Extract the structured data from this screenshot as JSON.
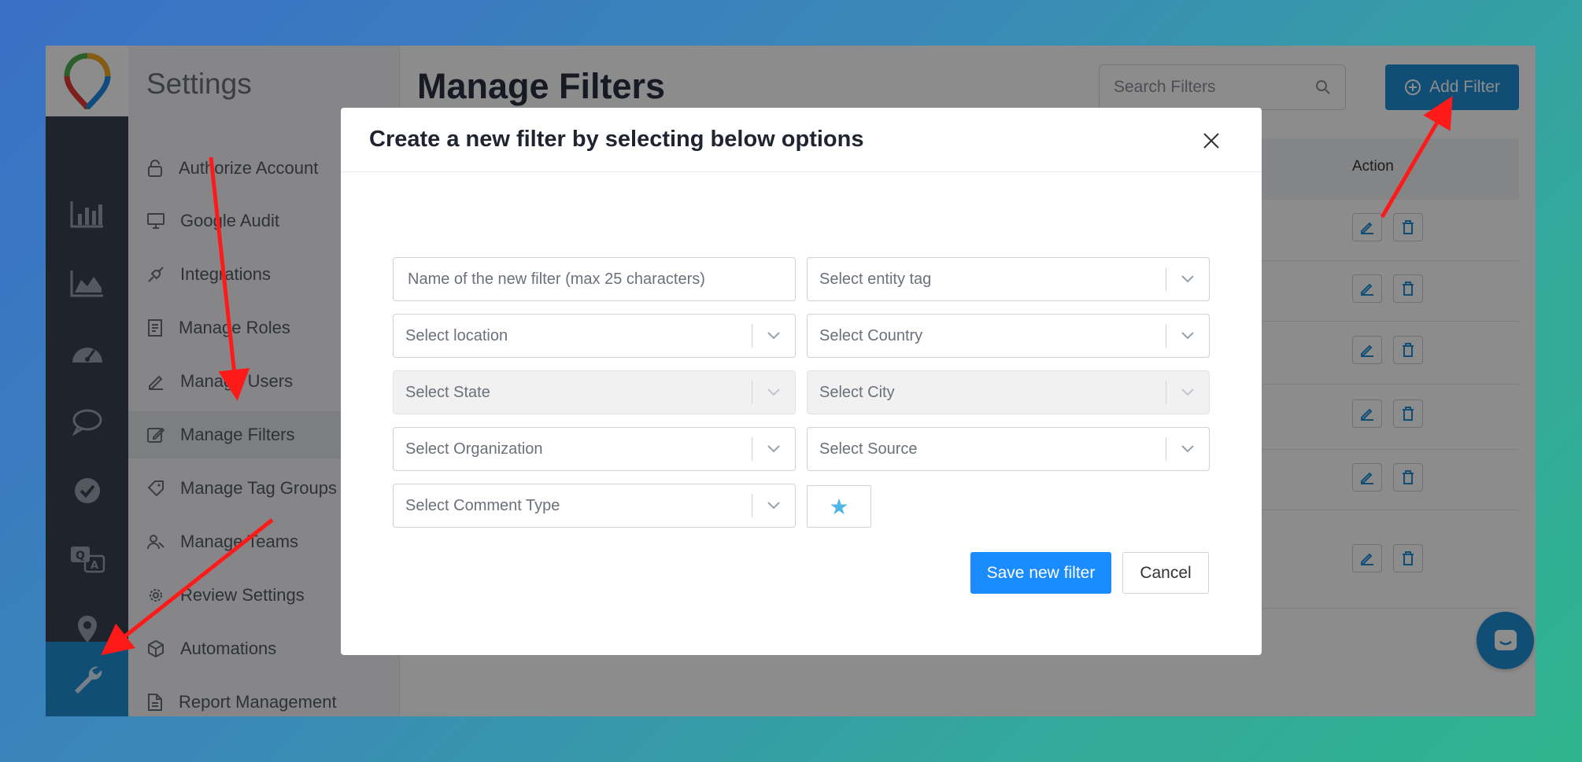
{
  "settings": {
    "title": "Settings",
    "items": [
      {
        "label": "Authorize Account",
        "icon": "lock-icon"
      },
      {
        "label": "Google Audit",
        "icon": "monitor-icon"
      },
      {
        "label": "Integrations",
        "icon": "plug-icon"
      },
      {
        "label": "Manage Roles",
        "icon": "document-list-icon"
      },
      {
        "label": "Manage Users",
        "icon": "pencil-icon"
      },
      {
        "label": "Manage Filters",
        "icon": "edit-square-icon",
        "active": true
      },
      {
        "label": "Manage Tag Groups",
        "icon": "tag-icon"
      },
      {
        "label": "Manage Teams",
        "icon": "users-icon"
      },
      {
        "label": "Review Settings",
        "icon": "gear-icon"
      },
      {
        "label": "Automations",
        "icon": "cube-icon"
      },
      {
        "label": "Report Management",
        "icon": "file-icon"
      }
    ]
  },
  "header": {
    "page_title": "Manage Filters",
    "search_placeholder": "Search Filters",
    "add_filter_label": "Add Filter"
  },
  "table": {
    "action_header": "Action"
  },
  "modal": {
    "title": "Create a new filter by selecting below options",
    "name_placeholder": "Name of the new filter (max 25 characters)",
    "entity_tag": "Select entity tag",
    "location": "Select location",
    "country": "Select Country",
    "state": "Select State",
    "city": "Select City",
    "organization": "Select Organization",
    "source": "Select Source",
    "comment_type": "Select Comment Type",
    "star": "★",
    "save_label": "Save new filter",
    "cancel_label": "Cancel"
  },
  "colors": {
    "accent": "#1e8fd8",
    "save_button": "#1a8cff",
    "arrow": "#ff1a1a"
  }
}
